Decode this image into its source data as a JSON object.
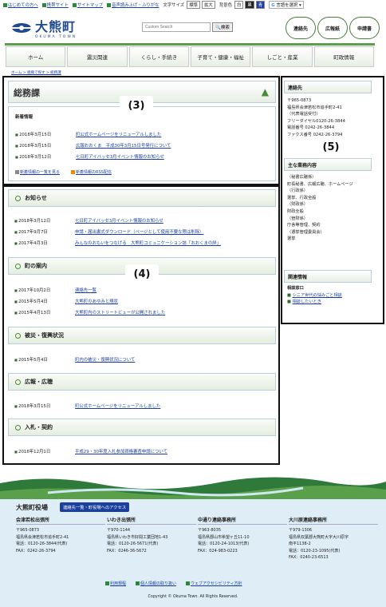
{
  "topbar": {
    "links": [
      "はじめての方へ",
      "携帯サイト",
      "サイトマップ",
      "音声読み上げ・ふりがな"
    ],
    "font_size_label": "文字サイズ",
    "font_sizes": [
      "標準",
      "拡大"
    ],
    "bg_label": "背景色",
    "bg_options": [
      "白",
      "黒",
      "青"
    ],
    "lang": "言語を選択"
  },
  "header": {
    "logo_name": "大熊町",
    "logo_sub": "OKUMA TOWN",
    "search_placeholder": "Custom Search",
    "search_button": "検索",
    "circle_buttons": [
      "連絡先",
      "広報紙",
      "申請書"
    ]
  },
  "nav": [
    "ホーム",
    "震災関連",
    "くらし・手続き",
    "子育て・健康・福祉",
    "しごと・産業",
    "町政情報"
  ],
  "breadcrumb": "ホーム > 組織で探す > 総務課",
  "page_title": "総務課",
  "labels": {
    "l3": "(3)",
    "l4": "(4)",
    "l5": "(5)"
  },
  "new_info": {
    "heading": "新着情報",
    "items": [
      {
        "date": "2018年3月15日",
        "text": "町公式ホームページをリニューアルしました"
      },
      {
        "date": "2018年3月15日",
        "text": "広報おおくま　平成30年3月15日号発行について"
      },
      {
        "date": "2018年3月12日",
        "text": "七日町アイバッセ3月イベント情報のお知らせ"
      }
    ],
    "more_list": "新着情報の一覧を見る",
    "rss": "新着情報のRSS配信"
  },
  "sections": [
    {
      "title": "お知らせ",
      "items": [
        {
          "date": "2018年3月12日",
          "text": "七日町アイバッセ3月イベント情報のお知らせ"
        },
        {
          "date": "2017年9月7日",
          "text": "申請・届出書式ダウンロード（ページとして使用不要な際は削除）"
        },
        {
          "date": "2017年4月3日",
          "text": "みんなのおもいをつなげる　大熊町コミュニケーション誌「おおくまの絆」"
        }
      ]
    },
    {
      "title": "町の案内",
      "items": [
        {
          "date": "2017年10月2日",
          "text": "連絡先一覧"
        },
        {
          "date": "2015年5月4日",
          "text": "大熊町のあゆみと現状"
        },
        {
          "date": "2015年4月13日",
          "text": "大熊町内のストリートビューが公開されました"
        }
      ]
    },
    {
      "title": "被災・復興状況",
      "items": [
        {
          "date": "2015年5月4日",
          "text": "町内の被災・復興状況について"
        }
      ]
    },
    {
      "title": "広報・広聴",
      "items": [
        {
          "date": "2018年3月15日",
          "text": "町公式ホームページをリニューアルしました"
        }
      ]
    },
    {
      "title": "入札・契約",
      "items": [
        {
          "date": "2016年12月1日",
          "text": "平成29・30年度入札参加資格審査申請について"
        }
      ]
    }
  ],
  "sidebar": {
    "contact": {
      "heading": "連絡先",
      "lines": [
        "〒965-0873",
        "福島県会津若松市追手町2-41",
        "（代表電話受付）",
        "フリーダイヤル0120-26-3844",
        "電話番号 0242-26-3844",
        "ファクス番号 0242-26-3794"
      ]
    },
    "work": {
      "heading": "主な業務内容",
      "lines": [
        "（秘書広聴係）",
        "町長秘書、広報広聴、ホームページ",
        "（行政係）",
        "選挙、行政全般",
        "（財政係）",
        "財政全般",
        "（管財係）",
        "庁舎等管理、契約",
        "（選挙管理委員会）",
        "選挙"
      ]
    },
    "related": {
      "heading": "関連情報",
      "sub": "相談窓口",
      "links": [
        "シニア世代の悩みごと相談",
        "相談したいとき"
      ]
    }
  },
  "footer": {
    "title": "大熊町役場",
    "access": "連絡先一覧・町役場へのアクセス",
    "offices": [
      {
        "name": "会津若松出張所",
        "lines": [
          "〒965-0873",
          "福島県会津若松市追手町2-41",
          "電話：0120-26-3844(代表)",
          "FAX：0242-26-3794"
        ]
      },
      {
        "name": "いわき出張所",
        "lines": [
          "〒970-1144",
          "福島県いわき市好間工業団地1-43",
          "電話：0120-26-5671(代表)",
          "FAX：0246-36-5672"
        ]
      },
      {
        "name": "中通り連絡事務所",
        "lines": [
          "〒963-8035",
          "福島県郡山市希望ヶ丘11-10",
          "電話：0120-24-1013(代表)",
          "FAX：024-983-0223"
        ]
      },
      {
        "name": "大川原連絡事務所",
        "lines": [
          "〒979-1306",
          "福島県双葉郡大熊町大字大川原字",
          "南平1138-2",
          "電話：0120-23-1095(代表)",
          "FAX：0240-23-6513"
        ]
      }
    ],
    "links": [
      "利用規程",
      "個人情報の取り扱い",
      "ウェブアクセシビリティ方針"
    ],
    "copyright": "Copyright © Okuma Town. All Rights Reserved."
  }
}
